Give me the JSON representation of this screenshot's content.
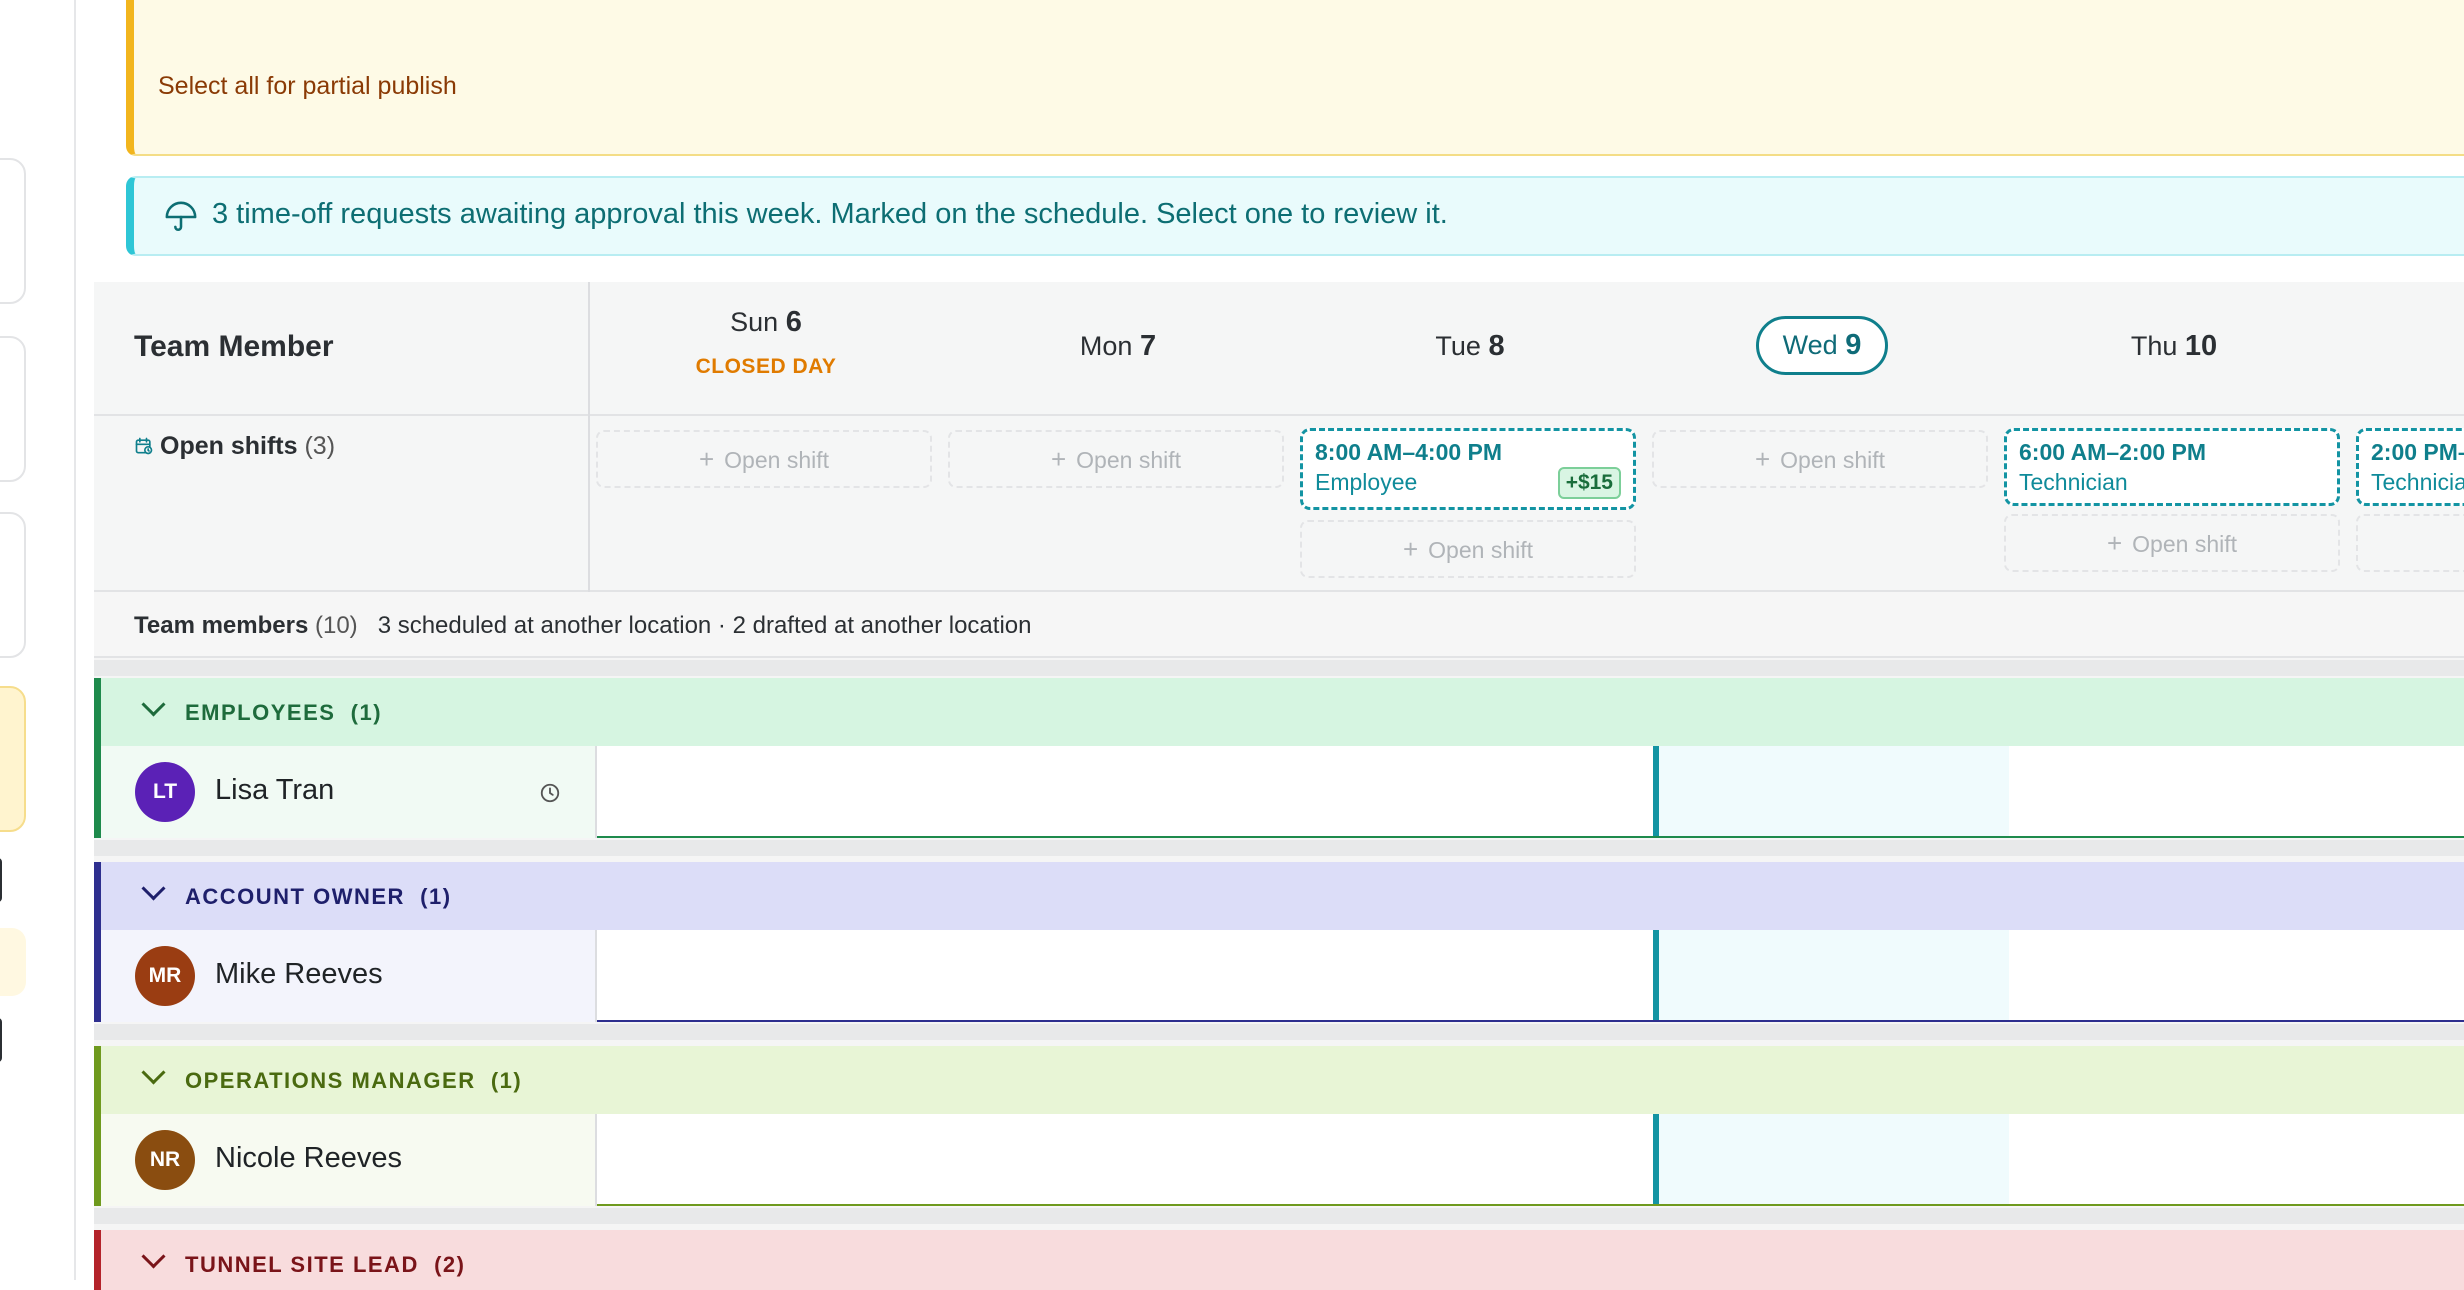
{
  "banners": {
    "publish": {
      "link": "Select all for partial publish"
    },
    "timeoff": {
      "message": "3 time-off requests awaiting approval this week. Marked on the schedule. Select one to review it.",
      "icon": "umbrella-icon"
    }
  },
  "grid": {
    "team_member_header": "Team Member",
    "days": [
      {
        "name": "Sun",
        "num": "6",
        "note": "CLOSED DAY"
      },
      {
        "name": "Mon",
        "num": "7"
      },
      {
        "name": "Tue",
        "num": "8"
      },
      {
        "name": "Wed",
        "num": "9",
        "today": true
      },
      {
        "name": "Thu",
        "num": "10"
      }
    ],
    "open_shifts": {
      "label": "Open shifts",
      "count": "(3)",
      "icon": "calendar-clock-icon",
      "add_label": "Open shift",
      "shifts": [
        {
          "time": "8:00 AM–4:00 PM",
          "role": "Employee",
          "bonus": "+$15"
        },
        {
          "time": "6:00 AM–2:00 PM",
          "role": "Technician"
        },
        {
          "time": "2:00 PM–",
          "role": "Technicia"
        }
      ]
    },
    "team_members": {
      "label": "Team members",
      "count": "(10)",
      "note": "3 scheduled at another location · 2 drafted at another location"
    },
    "groups": [
      {
        "label": "EMPLOYEES",
        "count": "(1)",
        "color": "#1e8a4c",
        "bg": "#d6f5e1",
        "member": {
          "initials": "LT",
          "name": "Lisa Tran",
          "avatar": "#5b21b6",
          "rowbg": "#f1faf4"
        }
      },
      {
        "label": "ACCOUNT OWNER",
        "count": "(1)",
        "color": "#2e2f8f",
        "bg": "#dcddf8",
        "member": {
          "initials": "MR",
          "name": "Mike Reeves",
          "avatar": "#9a3d12",
          "rowbg": "#f3f4fc"
        }
      },
      {
        "label": "OPERATIONS MANAGER",
        "count": "(1)",
        "color": "#5a7a14",
        "bg": "#e8f5d6",
        "member": {
          "initials": "NR",
          "name": "Nicole Reeves",
          "avatar": "#8a4d10",
          "rowbg": "#f7faf1"
        }
      },
      {
        "label": "TUNNEL SITE LEAD",
        "count": "(2)",
        "color": "#b4232a",
        "bg": "#f8dcdd"
      }
    ]
  }
}
